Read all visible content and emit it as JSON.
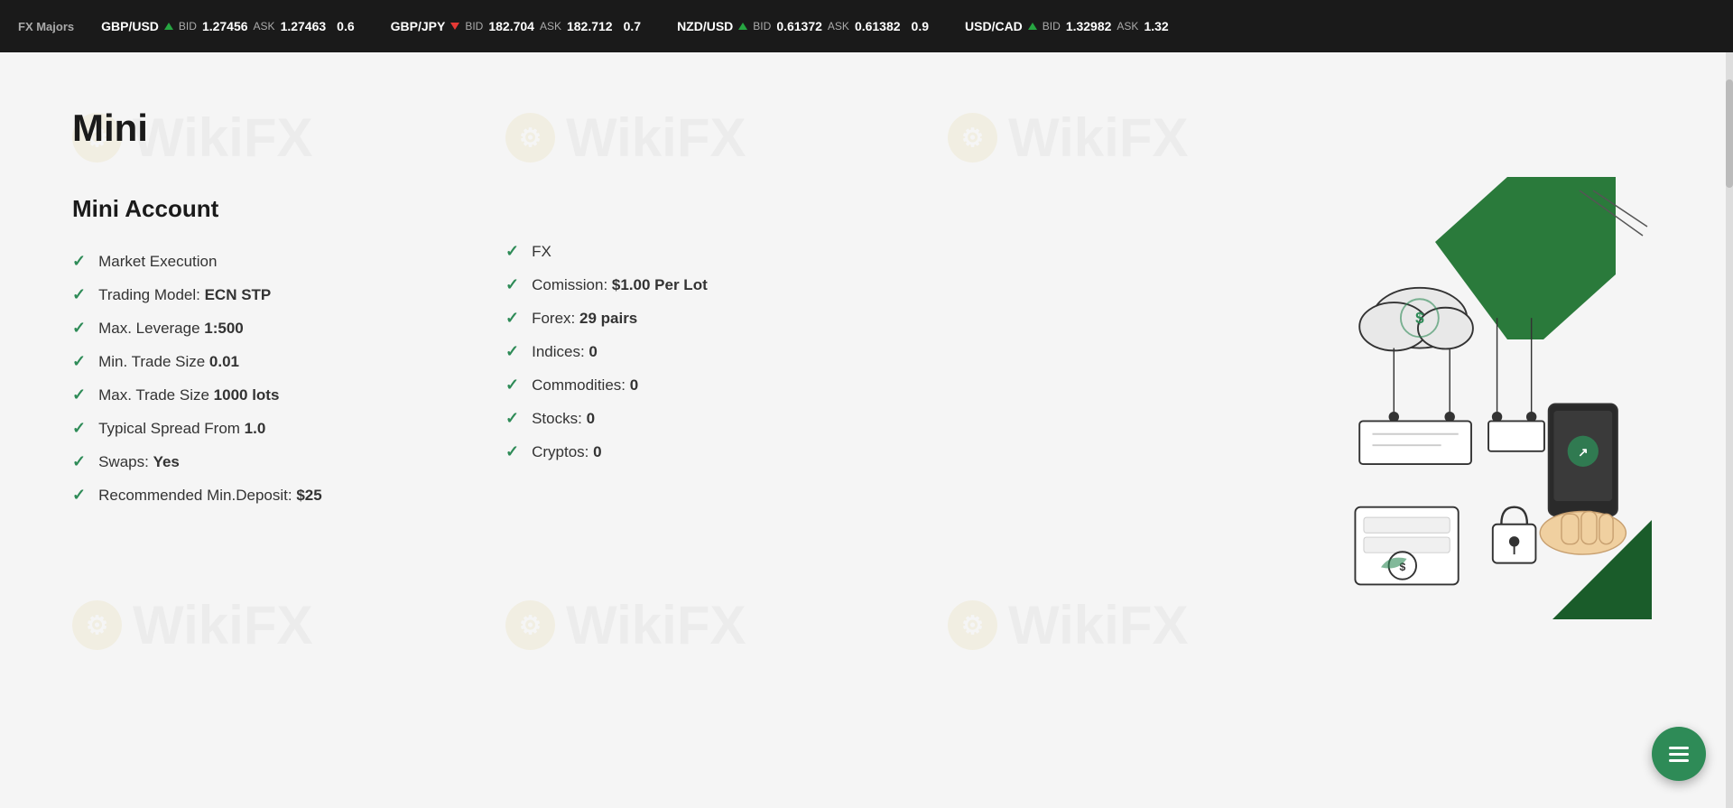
{
  "ticker": {
    "label": "FX Majors",
    "items": [
      {
        "pair": "GBP/USD",
        "direction": "up",
        "bid_label": "BID",
        "bid": "1.27456",
        "ask_label": "ASK",
        "ask": "1.27463",
        "spread": "0.6"
      },
      {
        "pair": "GBP/JPY",
        "direction": "down",
        "bid_label": "BID",
        "bid": "182.704",
        "ask_label": "ASK",
        "ask": "182.712",
        "spread": "0.7"
      },
      {
        "pair": "NZD/USD",
        "direction": "up",
        "bid_label": "BID",
        "bid": "0.61372",
        "ask_label": "ASK",
        "ask": "0.61382",
        "spread": "0.9"
      },
      {
        "pair": "USD/CAD",
        "direction": "up",
        "bid_label": "BID",
        "bid": "1.32982",
        "ask_label": "ASK",
        "ask": "1.32",
        "spread": ""
      }
    ]
  },
  "page": {
    "title": "Mini",
    "account_title": "Mini Account",
    "features_left": [
      {
        "label": "Market Execution",
        "value": ""
      },
      {
        "label": "Trading Model: ",
        "value": "ECN STP"
      },
      {
        "label": "Max. Leverage ",
        "value": "1:500"
      },
      {
        "label": "Min. Trade Size ",
        "value": "0.01"
      },
      {
        "label": "Max. Trade Size ",
        "value": "1000 lots"
      },
      {
        "label": "Typical Spread From ",
        "value": "1.0"
      },
      {
        "label": "Swaps: ",
        "value": "Yes"
      },
      {
        "label": "Recommended Min.Deposit: ",
        "value": "$25"
      }
    ],
    "features_right": [
      {
        "label": "FX",
        "value": ""
      },
      {
        "label": "Comission: ",
        "value": "$1.00 Per Lot"
      },
      {
        "label": "Forex: ",
        "value": "29 pairs"
      },
      {
        "label": "Indices: ",
        "value": "0"
      },
      {
        "label": "Commodities: ",
        "value": "0"
      },
      {
        "label": "Stocks: ",
        "value": "0"
      },
      {
        "label": "Cryptos: ",
        "value": "0"
      }
    ]
  },
  "chat_button": {
    "aria_label": "Open chat"
  },
  "watermark_text": "WikiFX"
}
